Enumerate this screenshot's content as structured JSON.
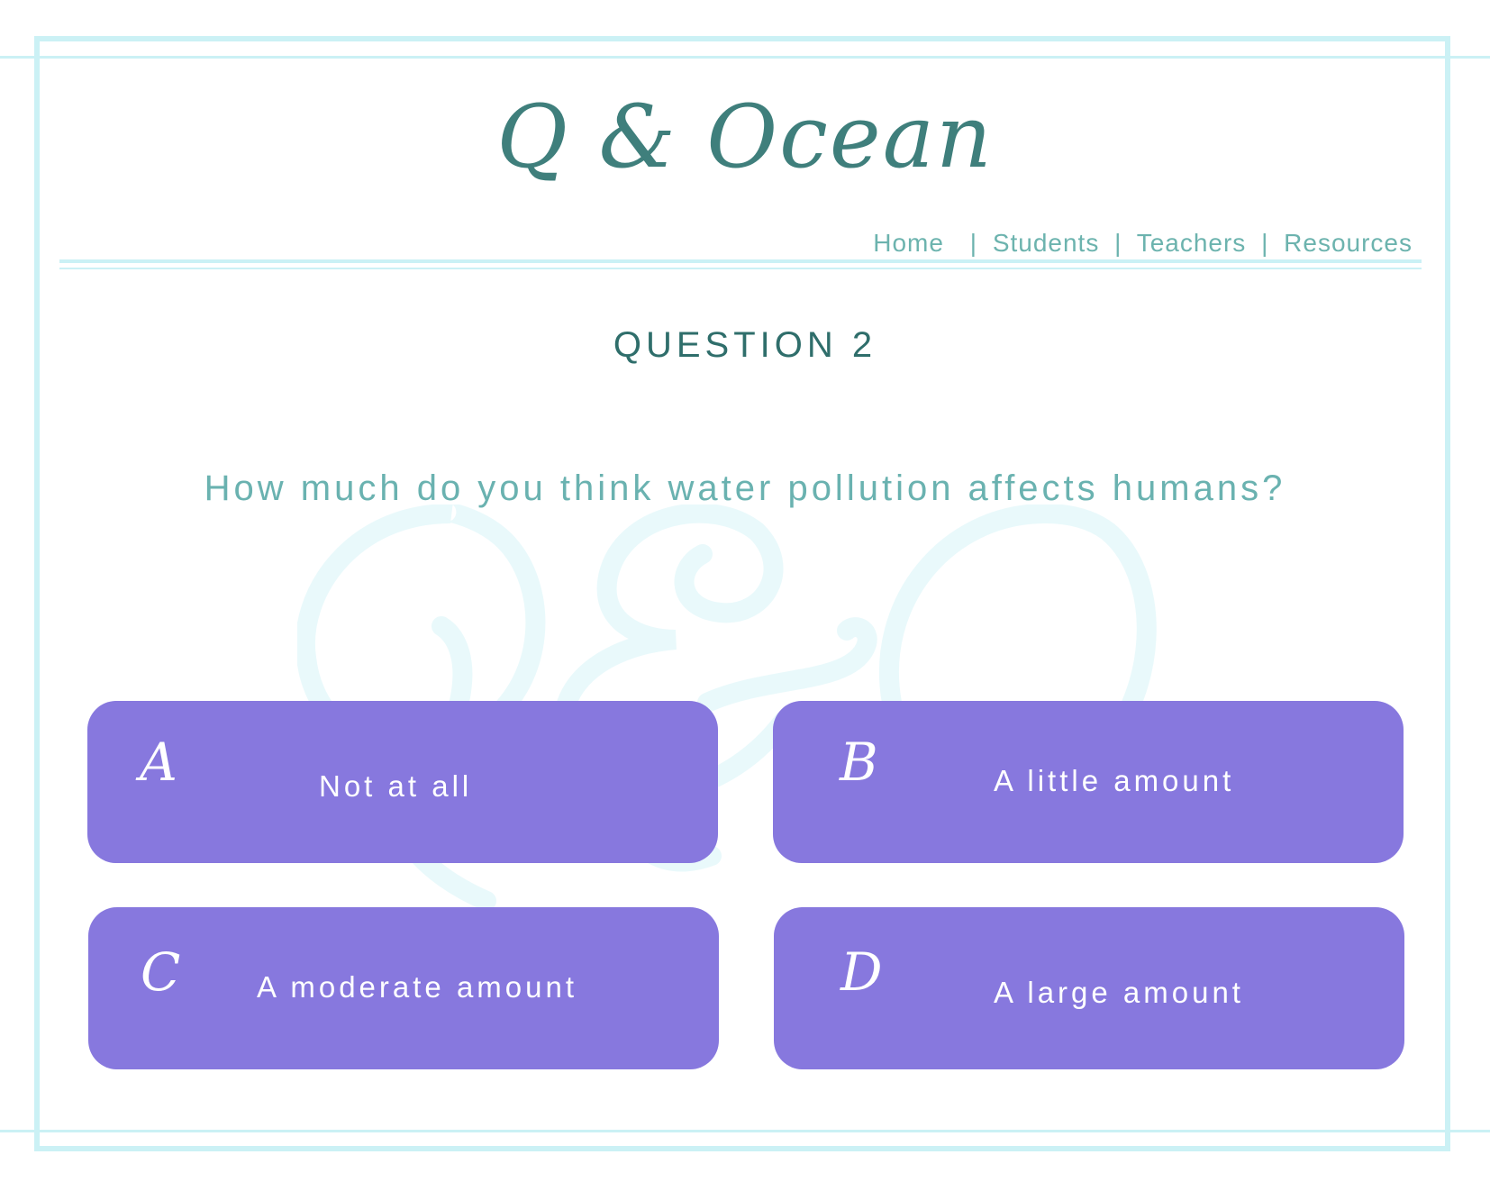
{
  "site": {
    "logo_text": "Q & Ocean"
  },
  "nav": {
    "items": [
      "Home",
      "Students",
      "Teachers",
      "Resources"
    ],
    "separator": "|"
  },
  "question": {
    "number_label": "QUESTION 2",
    "text": "How much do you think water pollution affects humans?"
  },
  "answers": [
    {
      "letter": "A",
      "label": "Not at all"
    },
    {
      "letter": "B",
      "label": "A little amount"
    },
    {
      "letter": "C",
      "label": "A moderate amount"
    },
    {
      "letter": "D",
      "label": "A large amount"
    }
  ],
  "colors": {
    "frame": "#cbf1f5",
    "logo": "#3f7f7c",
    "nav_text": "#6cb3ae",
    "question_number": "#2f6e6b",
    "question_text": "#6ab2b0",
    "answer_bg": "#8778de",
    "answer_text": "#ffffff",
    "watermark": "#e9f9fb"
  }
}
